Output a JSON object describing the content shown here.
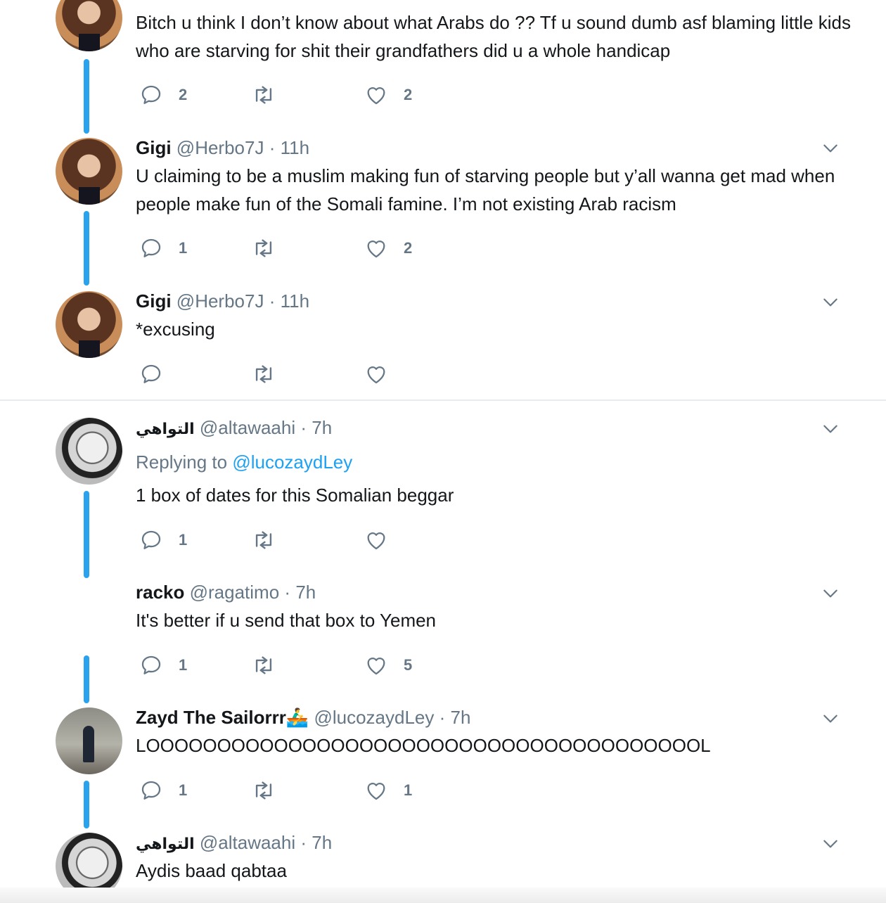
{
  "tweets": [
    {
      "text": "Bitch u think I don’t know about what Arabs do ?? Tf u sound dumb asf blaming little kids who are starving for shit their grandfathers did u a whole handicap",
      "reply_count": "2",
      "retweet_count": "",
      "like_count": "2"
    },
    {
      "name": "Gigi",
      "handle": "@Herbo7J",
      "dot": "·",
      "time": "11h",
      "text": "U claiming to be a muslim making fun of starving people but y’all wanna get mad when people make fun of the Somali famine. I’m not existing Arab racism",
      "reply_count": "1",
      "retweet_count": "",
      "like_count": "2"
    },
    {
      "name": "Gigi",
      "handle": "@Herbo7J",
      "dot": "·",
      "time": "11h",
      "text": "*excusing",
      "reply_count": "",
      "retweet_count": "",
      "like_count": ""
    },
    {
      "name": "التواهي",
      "handle": "@altawaahi",
      "dot": "·",
      "time": "7h",
      "replying_prefix": "Replying to",
      "replying_to": "@lucozaydLey",
      "text": "1 box of dates for this Somalian beggar",
      "reply_count": "1",
      "retweet_count": "",
      "like_count": ""
    },
    {
      "name": "racko",
      "handle": "@ragatimo",
      "dot": "·",
      "time": "7h",
      "text": "It's better if u send that box to Yemen",
      "reply_count": "1",
      "retweet_count": "",
      "like_count": "5"
    },
    {
      "name": "Zayd The Sailorrr🚣‍♂️",
      "handle": "@lucozaydLey",
      "dot": "·",
      "time": "7h",
      "text": "LOOOOOOOOOOOOOOOOOOOOOOOOOOOOOOOOOOOOOOOL",
      "reply_count": "1",
      "retweet_count": "",
      "like_count": "1"
    },
    {
      "name": "التواهي",
      "handle": "@altawaahi",
      "dot": "·",
      "time": "7h",
      "text": "Aydis baad qabtaa"
    }
  ],
  "icons": {
    "reply": "reply-icon",
    "retweet": "retweet-icon",
    "like": "heart-icon",
    "more": "chevron-down-icon"
  },
  "colors": {
    "accent": "#1da1f2",
    "thread_line": "#2aa3ef",
    "muted": "#657786",
    "text": "#14171a"
  }
}
